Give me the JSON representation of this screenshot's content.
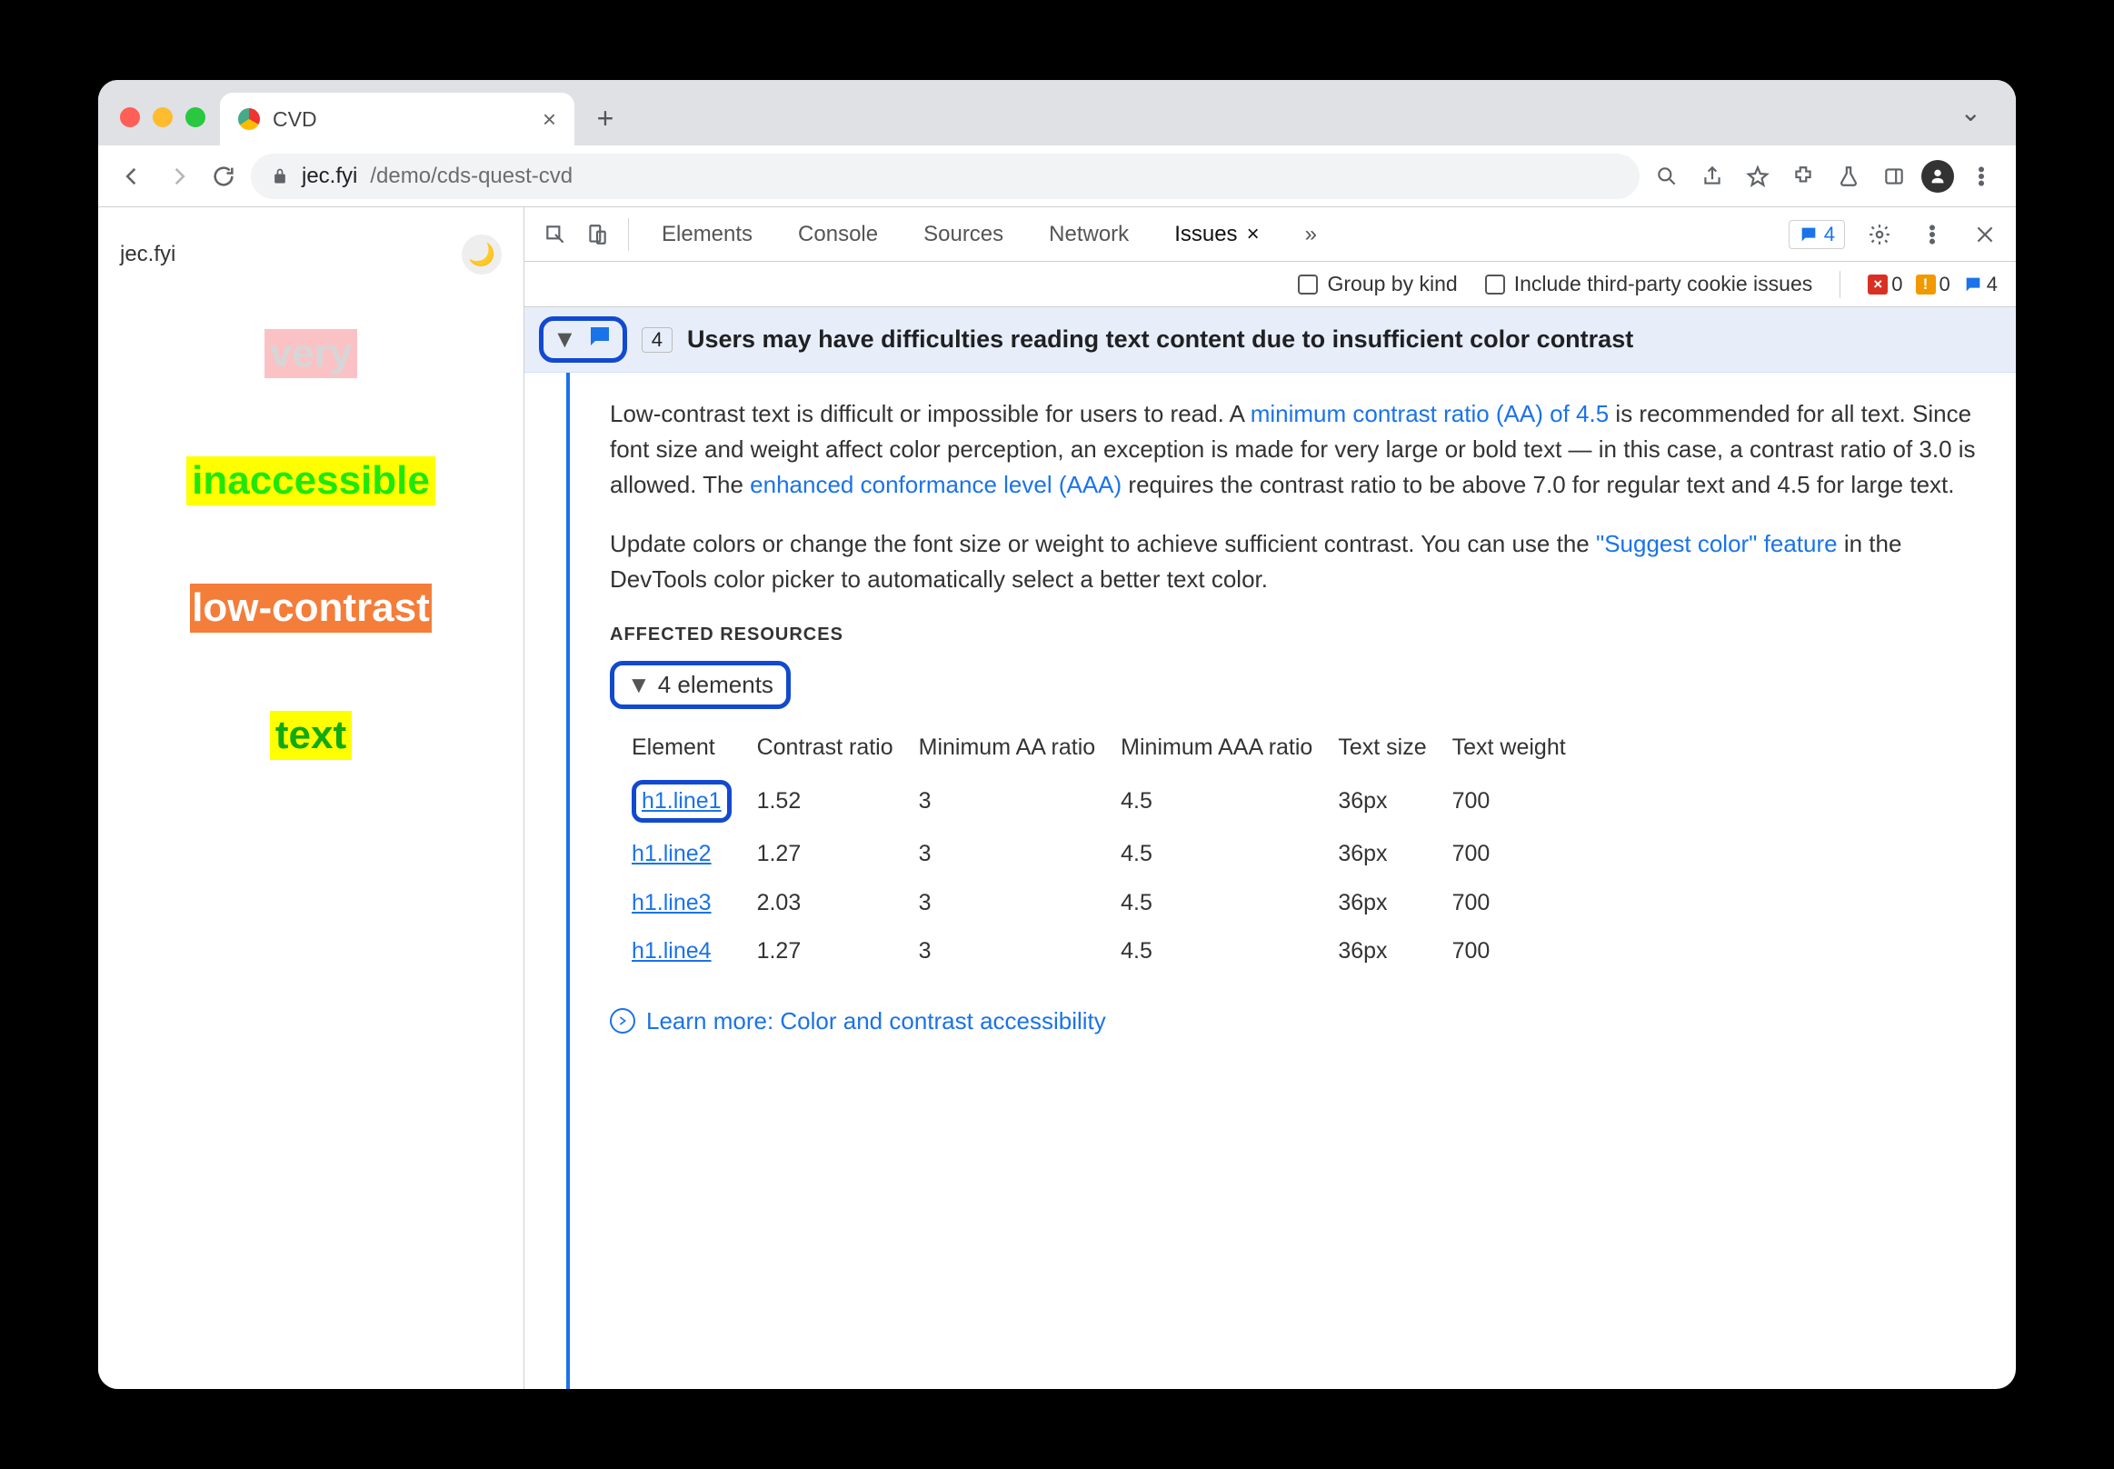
{
  "browser": {
    "tab_title": "CVD",
    "url_host": "jec.fyi",
    "url_path": "/demo/cds-quest-cvd"
  },
  "page": {
    "brand": "jec.fyi",
    "lines": [
      "very",
      "inaccessible",
      "low-contrast",
      "text"
    ]
  },
  "devtools": {
    "tabs": [
      "Elements",
      "Console",
      "Sources",
      "Network",
      "Issues"
    ],
    "issue_badge_count": "4",
    "subbar": {
      "group_by_kind": "Group by kind",
      "third_party": "Include third-party cookie issues",
      "counts": {
        "red": "0",
        "orange": "0",
        "blue": "4"
      }
    },
    "issue": {
      "count": "4",
      "title": "Users may have difficulties reading text content due to insufficient color contrast",
      "para1a": "Low-contrast text is difficult or impossible for users to read. A ",
      "link1": "minimum contrast ratio (AA) of 4.5",
      "para1b": " is recommended for all text. Since font size and weight affect color perception, an exception is made for very large or bold text — in this case, a contrast ratio of 3.0 is allowed. The ",
      "link2": "enhanced conformance level (AAA)",
      "para1c": " requires the contrast ratio to be above 7.0 for regular text and 4.5 for large text.",
      "para2a": "Update colors or change the font size or weight to achieve sufficient contrast. You can use the ",
      "link3": "\"Suggest color\" feature",
      "para2b": " in the DevTools color picker to automatically select a better text color.",
      "affected_heading": "AFFECTED RESOURCES",
      "affected_summary": "4 elements",
      "columns": [
        "Element",
        "Contrast ratio",
        "Minimum AA ratio",
        "Minimum AAA ratio",
        "Text size",
        "Text weight"
      ],
      "rows": [
        {
          "el": "h1.line1",
          "cr": "1.52",
          "aa": "3",
          "aaa": "4.5",
          "size": "36px",
          "weight": "700"
        },
        {
          "el": "h1.line2",
          "cr": "1.27",
          "aa": "3",
          "aaa": "4.5",
          "size": "36px",
          "weight": "700"
        },
        {
          "el": "h1.line3",
          "cr": "2.03",
          "aa": "3",
          "aaa": "4.5",
          "size": "36px",
          "weight": "700"
        },
        {
          "el": "h1.line4",
          "cr": "1.27",
          "aa": "3",
          "aaa": "4.5",
          "size": "36px",
          "weight": "700"
        }
      ],
      "learn_more": "Learn more: Color and contrast accessibility"
    }
  }
}
